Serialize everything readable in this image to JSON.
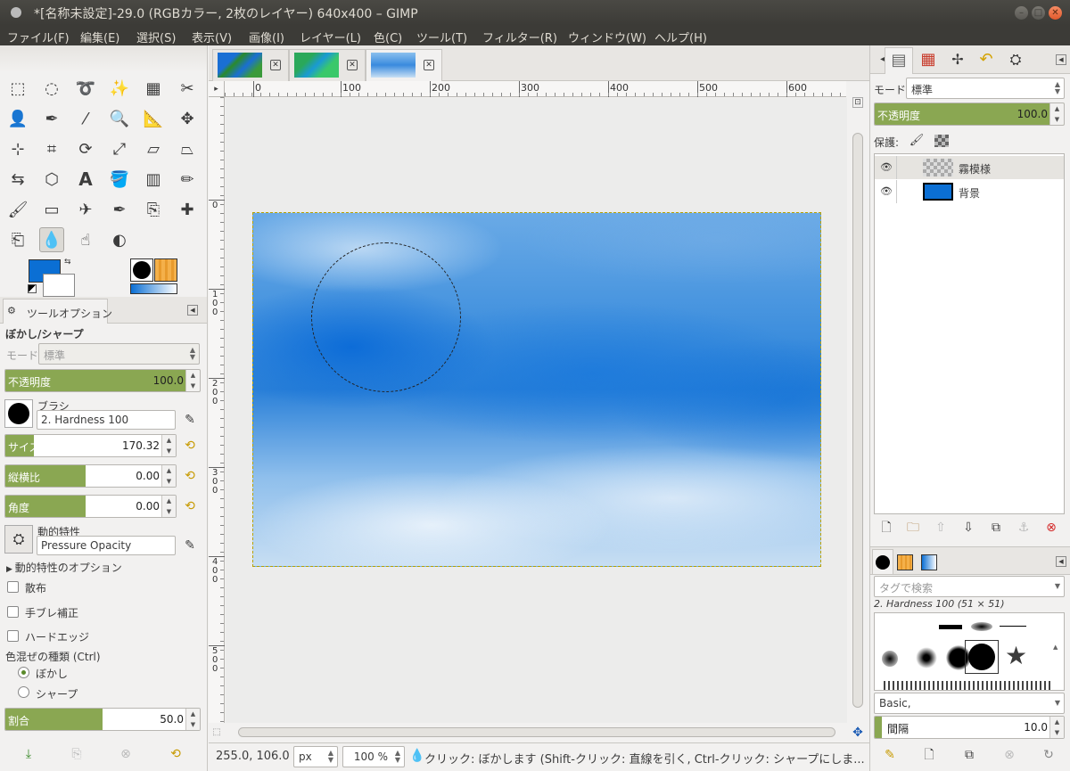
{
  "window": {
    "title": "*[名称未設定]-29.0 (RGBカラー, 2枚のレイヤー) 640x400 – GIMP"
  },
  "menu": [
    "ファイル(F)",
    "編集(E)",
    "選択(S)",
    "表示(V)",
    "画像(I)",
    "レイヤー(L)",
    "色(C)",
    "ツール(T)",
    "フィルター(R)",
    "ウィンドウ(W)",
    "ヘルプ(H)"
  ],
  "toolbox": {
    "tools": [
      "rect-select",
      "ellipse-select",
      "free-select",
      "fuzzy-select",
      "color-select",
      "scissors-select",
      "foreground-select",
      "paths",
      "color-picker",
      "zoom",
      "measure",
      "move",
      "align",
      "crop",
      "rotate",
      "scale",
      "shear",
      "perspective",
      "flip",
      "cage-transform",
      "text",
      "bucket-fill",
      "blend",
      "pencil",
      "paintbrush",
      "eraser",
      "airbrush",
      "ink",
      "clone",
      "heal",
      "perspective-clone",
      "blur-sharpen",
      "smudge",
      "dodge-burn"
    ],
    "active_tool": "blur-sharpen",
    "fg_color": "#0b6fd4",
    "bg_color": "#ffffff"
  },
  "tool_options": {
    "tab_label": "ツールオプション",
    "title": "ぼかし/シャープ",
    "mode_label": "モード:",
    "mode_value": "標準",
    "opacity": {
      "label": "不透明度",
      "value": "100.0",
      "fraction": 1.0
    },
    "brush_label": "ブラシ",
    "brush_value": "2. Hardness 100",
    "size": {
      "label": "サイズ",
      "value": "170.32",
      "fraction": 0.17
    },
    "aspect": {
      "label": "縦横比",
      "value": "0.00",
      "fraction": 0.5
    },
    "angle": {
      "label": "角度",
      "value": "0.00",
      "fraction": 0.5
    },
    "dynamics_label": "動的特性",
    "dynamics_value": "Pressure Opacity",
    "dynamics_options": "動的特性のオプション",
    "scatter": "散布",
    "jitter": "手ブレ補正",
    "hard_edge": "ハードエッジ",
    "convolve_label": "色混ぜの種類 (Ctrl)",
    "blur": "ぼかし",
    "sharpen": "シャープ",
    "rate": {
      "label": "割合",
      "value": "50.0",
      "fraction": 0.5
    }
  },
  "image_tabs": [
    {
      "name": "image-1",
      "active": false
    },
    {
      "name": "image-2",
      "active": false
    },
    {
      "name": "image-3",
      "active": true
    }
  ],
  "ruler": {
    "h_ticks": [
      "0",
      "100",
      "200",
      "300",
      "400",
      "500",
      "600"
    ],
    "v_ticks": [
      "0",
      "100",
      "200",
      "300",
      "400",
      "500"
    ]
  },
  "statusbar": {
    "coords": "255.0, 106.0",
    "unit": "px",
    "zoom": "100 %",
    "message": "クリック: ぼかします (Shift-クリック: 直線を引く, Ctrl-クリック: シャープにしま..."
  },
  "layers": {
    "mode_label": "モード:",
    "mode_value": "標準",
    "opacity": {
      "label": "不透明度",
      "value": "100.0",
      "fraction": 1.0
    },
    "lock_label": "保護:",
    "items": [
      {
        "name": "霧模様",
        "visible": true
      },
      {
        "name": "背景",
        "visible": true
      }
    ]
  },
  "brushes": {
    "tag_placeholder": "タグで検索",
    "selected": "2. Hardness 100 (51 × 51)",
    "preset": "Basic,",
    "spacing": {
      "label": "間隔",
      "value": "10.0",
      "fraction": 0.04
    }
  }
}
